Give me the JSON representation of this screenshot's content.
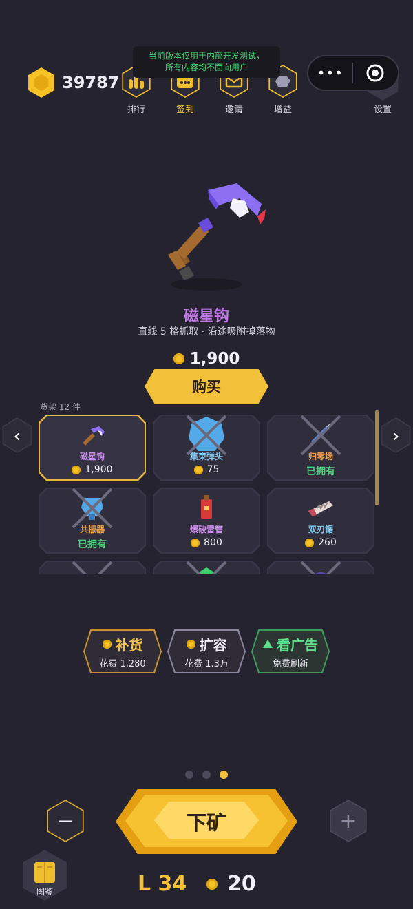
{
  "header": {
    "coins": "39787",
    "dev_notice_line1": "当前版本仅用于内部开发测试，",
    "dev_notice_line2": "所有内容均不面向用户",
    "nav": [
      {
        "label": "排行",
        "icon": "ranking-icon"
      },
      {
        "label": "签到",
        "icon": "checkin-calendar-icon"
      },
      {
        "label": "邀请",
        "icon": "invite-mail-icon"
      },
      {
        "label": "增益",
        "icon": "boost-ore-icon"
      }
    ],
    "settings_label": "设置",
    "capsule_more": "•••"
  },
  "featured": {
    "name": "磁星钩",
    "description": "直线 5 格抓取 · 沿途吸附掉落物",
    "price": "1,900",
    "buy_label": "购买",
    "name_color": "#c077e6"
  },
  "shelf": {
    "label": "货架 12 件",
    "items": [
      {
        "name": "磁星钩",
        "status": "1,900",
        "owned": false,
        "selected": true,
        "crossed": false,
        "name_color": "#c88ae8"
      },
      {
        "name": "集束弹头",
        "status": "75",
        "owned": false,
        "selected": false,
        "crossed": true,
        "name_color": "#7ec8f0"
      },
      {
        "name": "归零场",
        "status": "已拥有",
        "owned": true,
        "selected": false,
        "crossed": true,
        "name_color": "#f0a050"
      },
      {
        "name": "共振器",
        "status": "已拥有",
        "owned": true,
        "selected": false,
        "crossed": true,
        "name_color": "#f0a050"
      },
      {
        "name": "爆破雷管",
        "status": "800",
        "owned": false,
        "selected": false,
        "crossed": false,
        "name_color": "#c88ae8"
      },
      {
        "name": "双刃锯",
        "status": "260",
        "owned": false,
        "selected": false,
        "crossed": false,
        "name_color": "#7ec8f0"
      }
    ]
  },
  "actions": {
    "restock": {
      "title": "补货",
      "sub": "花费 1,280",
      "color": "#f2c146"
    },
    "expand": {
      "title": "扩容",
      "sub": "花费 1.3万",
      "color": "#f2f0f8"
    },
    "watch_ad": {
      "title": "看广告",
      "sub": "免费刷新",
      "color": "#5fe08a"
    }
  },
  "pager": {
    "count": 3,
    "active": 3
  },
  "footer": {
    "mine_label": "下矿",
    "minus": "−",
    "plus": "+",
    "level": "L 34",
    "gems": "20",
    "codex_label": "图鉴"
  },
  "colors": {
    "background": "#25232f",
    "gold": "#f4c13a",
    "owned_green": "#4fd07a"
  }
}
